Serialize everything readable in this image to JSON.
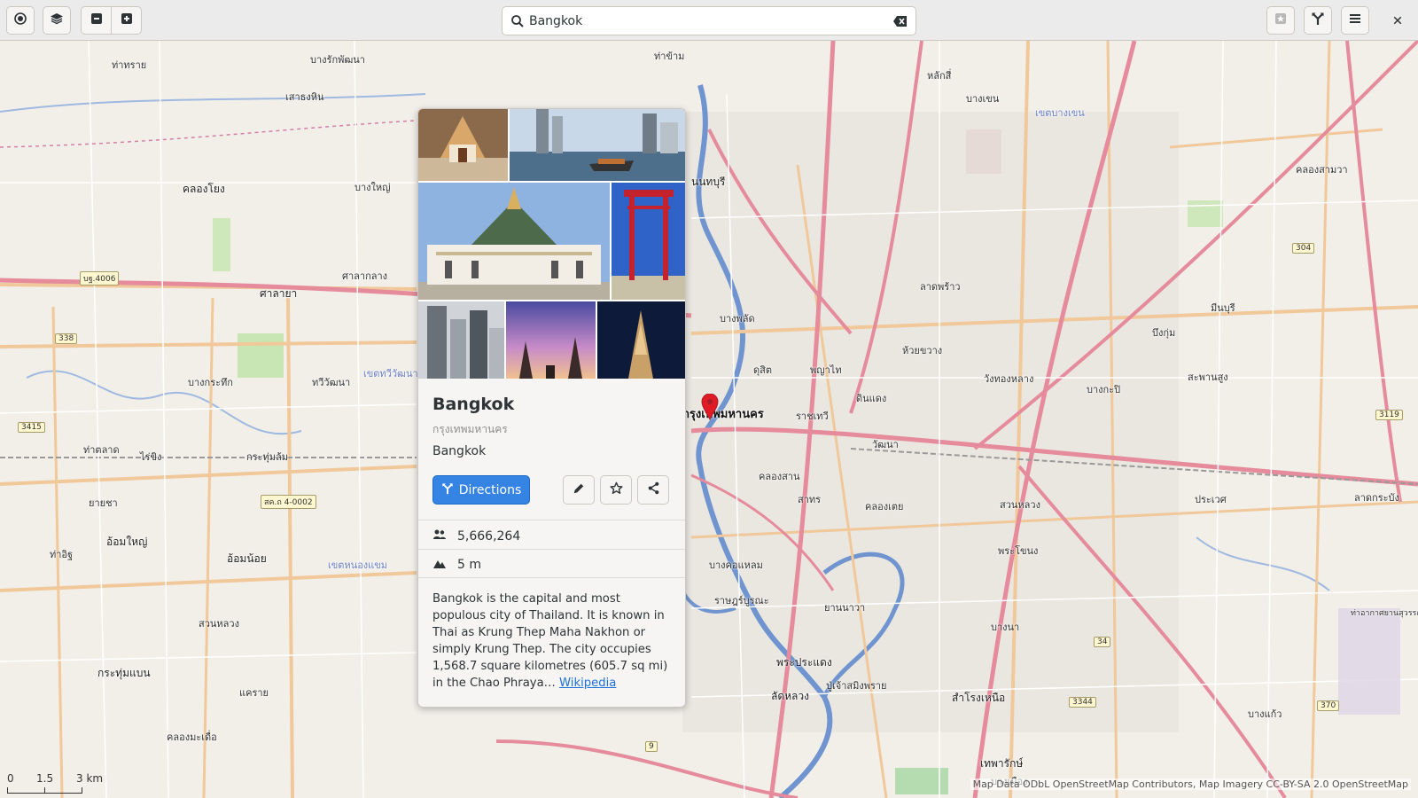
{
  "header": {
    "search_value": "Bangkok",
    "left_icons": [
      "locate-icon",
      "layers-icon",
      "zoom-out-icon",
      "zoom-in-icon"
    ],
    "right_icons": [
      "favorites-icon",
      "directions-icon",
      "menu-icon",
      "close-icon"
    ]
  },
  "place": {
    "name": "Bangkok",
    "native_name": "กรุงเทพมหานคร",
    "address": "Bangkok",
    "directions_label": "Directions",
    "population": "5,666,264",
    "altitude": "5 m",
    "description": "Bangkok is the capital and most populous city of Thailand. It is known in Thai as Krung Thep Maha Nakhon or simply Krung Thep. The city occupies 1,568.7 square kilometres (605.7 sq mi) in the Chao Phraya… ",
    "wiki_link": "Wikipedia",
    "action_icons": [
      "edit-icon",
      "star-icon",
      "share-icon"
    ]
  },
  "map": {
    "city_label": "กรุงเทพมหานคร",
    "labels": {
      "l1": "บางรักพัฒนา",
      "l2": "เสาธงหิน",
      "l3": "คลองโยง",
      "l4": "บางใหญ่",
      "l5": "ศาลายา",
      "l6": "ศาลากลาง",
      "l7": "บางกระทึก",
      "l8": "ทวีวัฒนา",
      "l9": "ไร่ขิง",
      "l10": "กระทุ่มล้ม",
      "l11": "อ้อมใหญ่",
      "l12": "อ้อมน้อย",
      "l13": "สวนหลวง",
      "l14": "กระทุ่มแบน",
      "l15": "แคราย",
      "l16": "คลองมะเดื่อ",
      "l17": "นนทบุรี",
      "l18": "ลาดพร้าว",
      "l19": "ห้วยขวาง",
      "l20": "ดินแดง",
      "l21": "วังทองหลาง",
      "l22": "บางกะปิ",
      "l23": "สะพานสูง",
      "l24": "บางเขน",
      "l25": "หลักสี่",
      "l26": "ราชเทวี",
      "l27": "วัฒนา",
      "l28": "สาทร",
      "l29": "คลองเตย",
      "l30": "พระโขนง",
      "l31": "สวนหลวง",
      "l32": "บางนา",
      "l33": "พระประแดง",
      "l34": "ปู่เจ้าสมิงพราย",
      "l35": "สำโรงเหนือ",
      "l36": "ลัดหลวง",
      "l37": "ประเวศ",
      "l38": "ลาดกระบัง",
      "l39": "บางแก้ว",
      "l40": "คลองสามวา",
      "l41": "มีนบุรี",
      "l42": "บึงกุ่ม",
      "l43": "ดุสิต",
      "l44": "พญาไท",
      "l45": "บางพลัด",
      "l46": "คลองสาน",
      "l47": "บางคอแหลม",
      "l48": "ราษฎร์บูรณะ",
      "l49": "ยานนาวา",
      "l50": "ท่าอิฐ",
      "l51": "ท่าทราย",
      "l52": "ยายชา",
      "l53": "ท่าตลาด",
      "l54": "ท่าข้าม",
      "l55": "เทพารักษ์",
      "l56": "บางเมือง",
      "l57": "ท่าอากาศยานสุวรรณภูมิ",
      "l58": "เขตหนองแขม",
      "l59": "เขตทวีวัฒนา",
      "l60": "เขตบางเขน"
    },
    "shields": [
      "บฐ.4006",
      "338",
      "3415",
      "สค.ถ 4-0002",
      "304",
      "3119",
      "34",
      "3344",
      "370",
      "9"
    ],
    "scale": {
      "zero": "0",
      "mid": "1.5",
      "max": "3 km"
    },
    "attribution": "Map Data ODbL OpenStreetMap Contributors, Map Imagery CC-BY-SA 2.0 OpenStreetMap"
  }
}
